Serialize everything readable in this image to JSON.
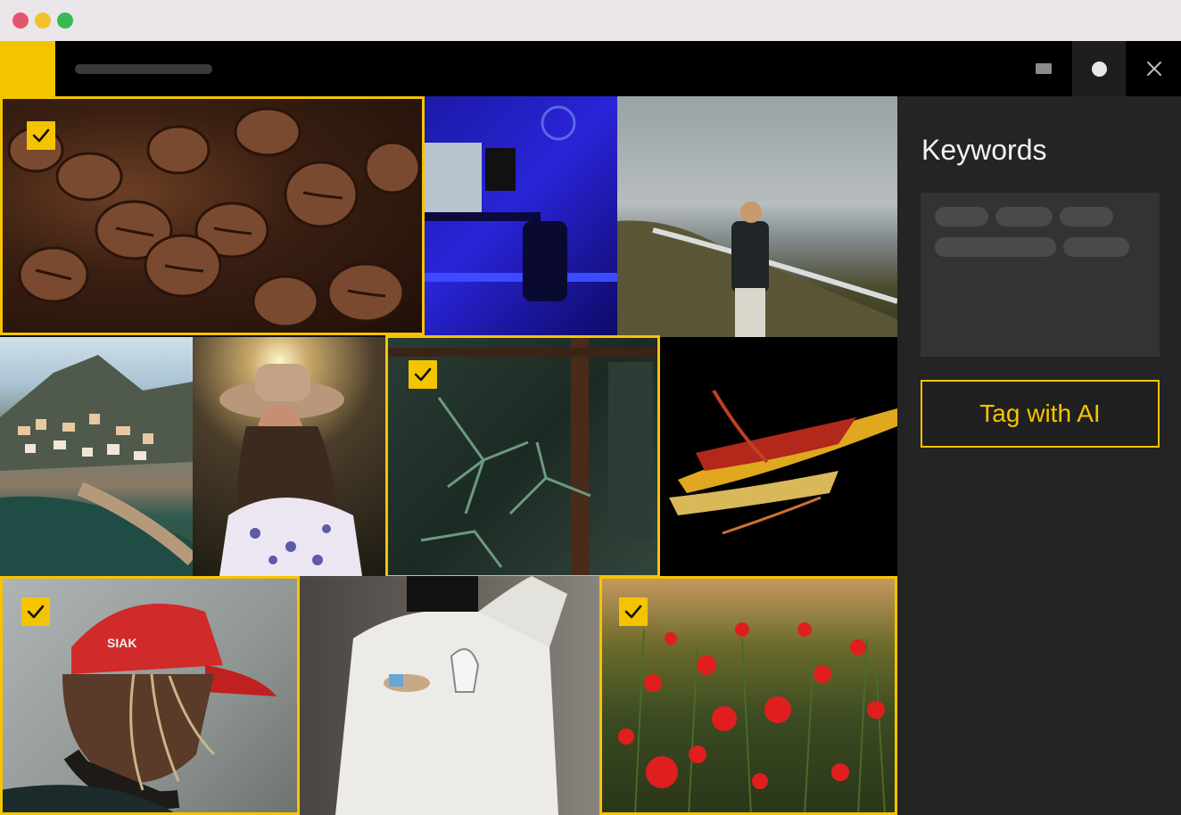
{
  "theme": {
    "accent": "#f5c400",
    "header_bg": "#000000",
    "sidebar_bg": "#242424"
  },
  "window": {
    "controls": [
      "close",
      "minimize",
      "zoom"
    ]
  },
  "header": {
    "window_buttons": [
      "minimize-icon",
      "maximize-icon",
      "close-icon"
    ]
  },
  "sidebar": {
    "title": "Keywords",
    "tag_button_label": "Tag with AI"
  },
  "photos": [
    {
      "subject": "coffee beans",
      "selected": true
    },
    {
      "subject": "blue-lit desk setup",
      "selected": false
    },
    {
      "subject": "woman on cliff by sea",
      "selected": false
    },
    {
      "subject": "coastal village",
      "selected": false
    },
    {
      "subject": "woman in hat",
      "selected": false
    },
    {
      "subject": "plant through window",
      "selected": true
    },
    {
      "subject": "abstract golden shards",
      "selected": false
    },
    {
      "subject": "man in red cap",
      "selected": true
    },
    {
      "subject": "person in white sweatshirt",
      "selected": false
    },
    {
      "subject": "red poppy field",
      "selected": true
    }
  ]
}
